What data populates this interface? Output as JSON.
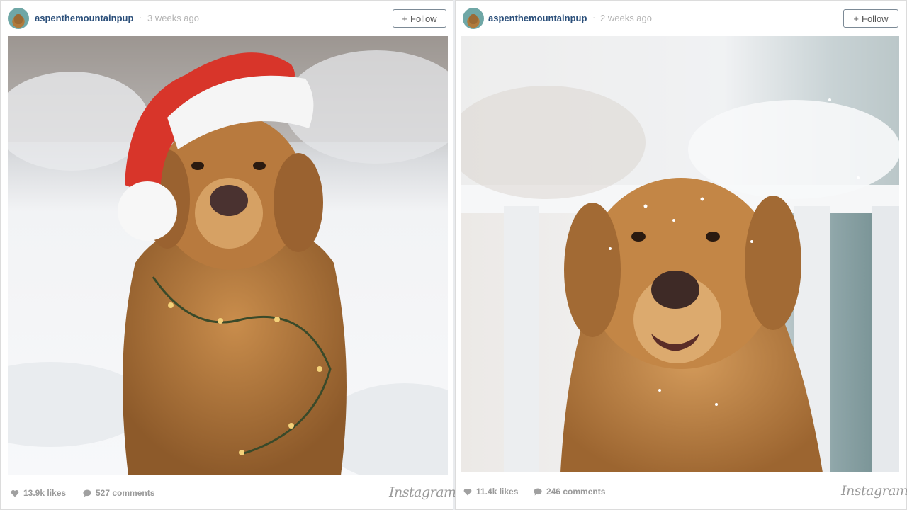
{
  "posts": [
    {
      "username": "aspenthemountainpup",
      "separator": "·",
      "time": "3 weeks ago",
      "follow_label": "Follow",
      "likes": "13.9k likes",
      "comments": "527 comments",
      "brand": "Instagram",
      "photo_subject": "golden-retriever-in-santa-hat-snow"
    },
    {
      "username": "aspenthemountainpup",
      "separator": "·",
      "time": "2 weeks ago",
      "follow_label": "Follow",
      "likes": "11.4k likes",
      "comments": "246 comments",
      "brand": "Instagram",
      "photo_subject": "golden-retriever-snowy-face"
    }
  ],
  "colors": {
    "username": "#2b4f7a",
    "muted": "#b4b4b4",
    "fur": "#b87a3e",
    "hat_red": "#d8352a",
    "snow": "#f4f6f8"
  },
  "icons": {
    "like": "heart-icon",
    "comment": "comment-icon",
    "follow": "plus-icon"
  }
}
